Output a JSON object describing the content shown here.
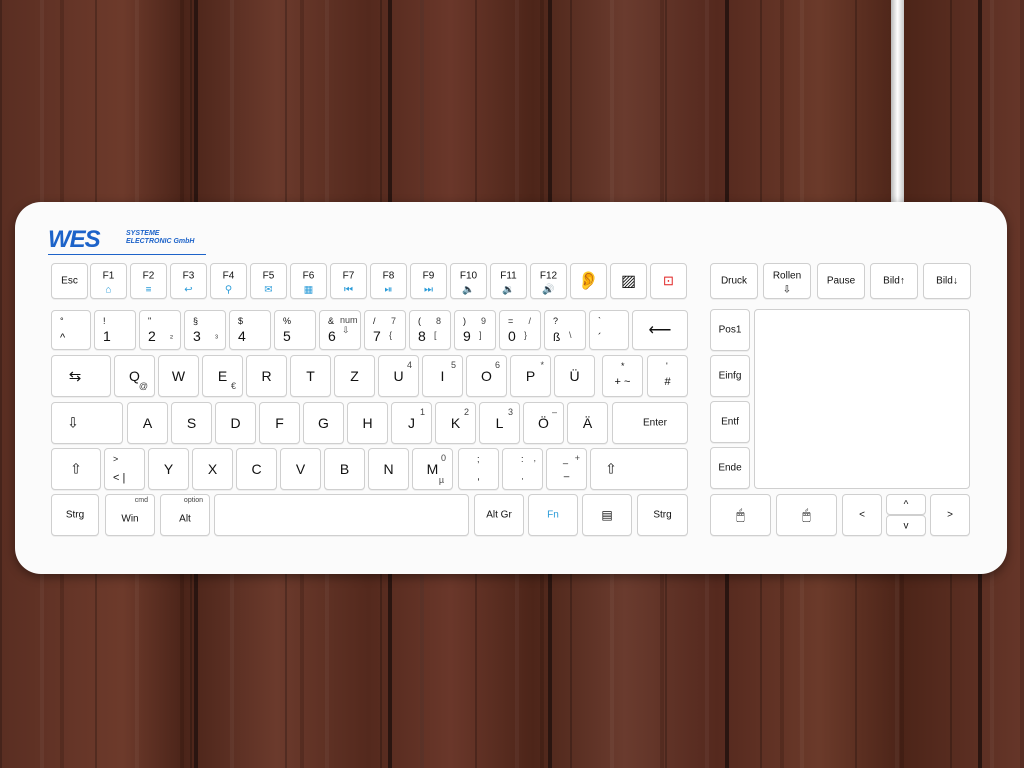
{
  "brand": {
    "logo": "WES",
    "line1": "SYSTEME",
    "line2": "ELECTRONIC GmbH",
    "color": "#1d63c9"
  },
  "accent": "#2a9bd8",
  "keys": {
    "esc": "Esc",
    "f1": "F1",
    "f2": "F2",
    "f3": "F3",
    "f4": "F4",
    "f5": "F5",
    "f6": "F6",
    "f7": "F7",
    "f8": "F8",
    "f9": "F9",
    "f10": "F10",
    "f11": "F11",
    "f12": "F12",
    "druck": "Druck",
    "rollen": "Rollen",
    "pause": "Pause",
    "bild_up": "Bild↑",
    "bild_down": "Bild↓",
    "q": "Q",
    "w": "W",
    "e": "E",
    "r": "R",
    "t": "T",
    "z": "Z",
    "u": "U",
    "i": "I",
    "o": "O",
    "p": "P",
    "ue": "Ü",
    "a": "A",
    "s": "S",
    "d": "D",
    "f": "F",
    "g": "G",
    "h": "H",
    "j": "J",
    "k": "K",
    "l": "L",
    "oe": "Ö",
    "ae": "Ä",
    "enter": "Enter",
    "y": "Y",
    "x": "X",
    "c": "C",
    "v": "V",
    "b": "B",
    "n": "N",
    "m": "M",
    "strg_left": "Strg",
    "win": "Win",
    "cmd": "cmd",
    "alt": "Alt",
    "option": "option",
    "altgr": "Alt Gr",
    "fn": "Fn",
    "strg_right": "Strg",
    "pos1": "Pos1",
    "einfg": "Einfg",
    "entf": "Entf",
    "ende": "Ende",
    "left": "<",
    "right": ">",
    "up": "^",
    "down": "v",
    "num": "num"
  }
}
